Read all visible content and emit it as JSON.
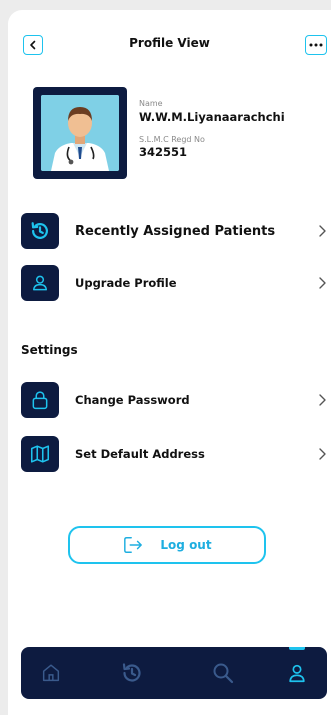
{
  "header": {
    "title": "Profile View",
    "back_icon": "chevron-left-icon",
    "more_icon": "more-horizontal-icon"
  },
  "profile": {
    "name_label": "Name",
    "name_value": "W.W.M.Liyanaarachchi",
    "reg_label": "S.L.M.C Regd No",
    "reg_value": "342551"
  },
  "menu": [
    {
      "label": "Recently Assigned Patients",
      "icon": "history-icon"
    },
    {
      "label": "Upgrade Profile",
      "icon": "user-icon"
    }
  ],
  "settings": {
    "heading": "Settings",
    "items": [
      {
        "label": "Change Password",
        "icon": "lock-icon"
      },
      {
        "label": "Set Default Address",
        "icon": "map-icon"
      }
    ]
  },
  "logout": {
    "label": "Log out",
    "icon": "logout-icon"
  },
  "bottom_nav": {
    "items": [
      "home-icon",
      "history-icon",
      "search-icon",
      "user-icon"
    ],
    "active": "user-icon"
  },
  "colors": {
    "navy": "#0d1b40",
    "accent": "#1ec3ee",
    "background": "#ffffff"
  }
}
